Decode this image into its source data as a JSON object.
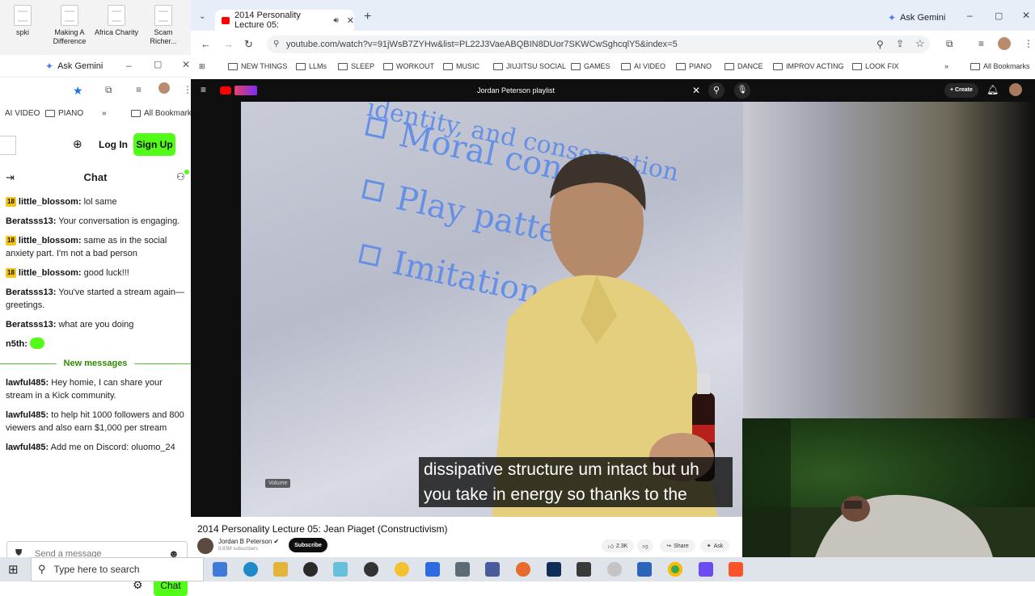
{
  "desktop": {
    "icons": [
      {
        "label": "spki",
        "name": "desktop-file-spki"
      },
      {
        "label": "Making A Difference",
        "name": "desktop-file-making-a-difference"
      },
      {
        "label": "Africa Charity",
        "name": "desktop-file-africa-charity"
      },
      {
        "label": "Scam Richer...",
        "name": "desktop-file-scam-richer"
      }
    ]
  },
  "kick_window": {
    "gemini": "Ask Gemini",
    "bookmarks": [
      "AI VIDEO",
      "PIANO",
      "All Bookmarks"
    ],
    "login": "Log In",
    "signup": "Sign Up",
    "chat_title": "Chat",
    "messages": [
      {
        "user": "little_blossom",
        "badge": "18",
        "text": " lol same"
      },
      {
        "user": "Beratsss13",
        "badge": "",
        "text": " Your conversation is engaging."
      },
      {
        "user": "little_blossom",
        "badge": "18",
        "text": " same as in the social anxiety part. I'm not a bad person"
      },
      {
        "user": "little_blossom",
        "badge": "18",
        "text": " good luck!!!"
      },
      {
        "user": "Beratsss13",
        "badge": "",
        "text": " You've started a stream again—greetings."
      },
      {
        "user": "Beratsss13",
        "badge": "",
        "text": " what are you doing"
      },
      {
        "user": "n5th",
        "badge": "",
        "text": " "
      }
    ],
    "new_messages_label": "New messages",
    "new_messages": [
      {
        "user": "lawful485",
        "text": " Hey homie, I can share your stream in a Kick community."
      },
      {
        "user": "lawful485",
        "text": " to help hit 1000 followers and 800 viewers and also earn $1,000 per stream"
      },
      {
        "user": "lawful485",
        "text": " Add me on Discord: oluomo_24"
      }
    ],
    "send_placeholder": "Send a message",
    "chat_button": "Chat"
  },
  "main_browser": {
    "tab_title": "2014 Personality Lecture 05:",
    "gemini": "Ask Gemini",
    "url": "youtube.com/watch?v=91jWsB7ZYHw&list=PL22J3VaeABQBIN8DUor7SKWCwSghcqlY5&index=5",
    "bookmarks": [
      "NEW THINGS",
      "LLMs",
      "SLEEP",
      "WORKOUT",
      "MUSIC",
      "JIUJITSU SOCIAL",
      "GAMES",
      "AI VIDEO",
      "PIANO",
      "DANCE",
      "IMPROV ACTING",
      "LOOK FIX"
    ],
    "all_bookmarks": "All Bookmarks"
  },
  "youtube": {
    "search_query": "Jordan Peterson playlist",
    "create_label": "Create",
    "slide_lines": [
      "Moral con",
      "Play patte",
      "Imitation"
    ],
    "slide_top": "identity, and conservation",
    "caption_line1": "dissipative structure um intact but uh",
    "caption_line2": "you take in energy so thanks to the",
    "volume_tooltip": "Volume",
    "video_title": "2014 Personality Lecture 05: Jean Piaget (Constructivism)",
    "channel": "Jordan B Peterson",
    "subscribers": "8.83M subscribers",
    "subscribe": "Subscribe",
    "likes": "2.3K",
    "share": "Share",
    "ask": "Ask"
  },
  "taskbar": {
    "search_placeholder": "Type here to search"
  }
}
